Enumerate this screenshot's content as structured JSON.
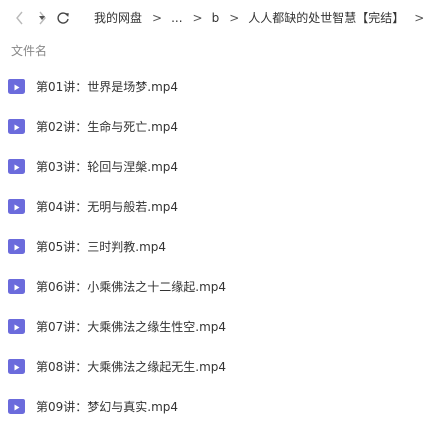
{
  "toolbar": {
    "breadcrumb": [
      "我的网盘",
      "...",
      "b",
      "人人都缺的处世智慧【完结】"
    ],
    "back_icon": "chevron-left-icon",
    "forward_icon": "chevron-right-icon",
    "history_icon": "caret-down-icon",
    "refresh_icon": "refresh-icon"
  },
  "list": {
    "column_header": "文件名",
    "file_icon": "video-file-icon",
    "icon_color": "#6b6bdc",
    "files": [
      "第01讲：世界是场梦.mp4",
      "第02讲：生命与死亡.mp4",
      "第03讲：轮回与涅槃.mp4",
      "第04讲：无明与般若.mp4",
      "第05讲：三时判教.mp4",
      "第06讲：小乘佛法之十二缘起.mp4",
      "第07讲：大乘佛法之缘生性空.mp4",
      "第08讲：大乘佛法之缘起无生.mp4",
      "第09讲：梦幻与真实.mp4"
    ]
  }
}
